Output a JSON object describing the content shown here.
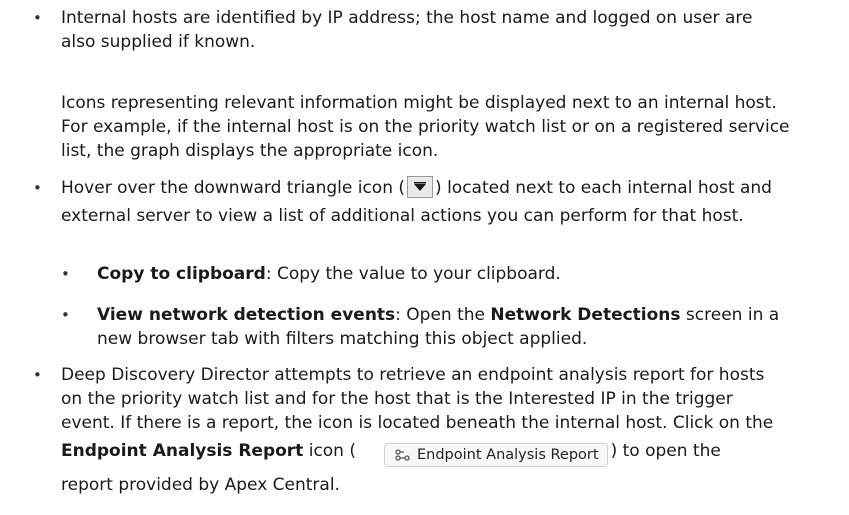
{
  "bullets": [
    {
      "lines": [
        "Internal hosts are identified by IP address; the host name and logged on user are",
        "also supplied if known."
      ],
      "paragraph": [
        "Icons representing relevant information might be displayed next to an internal host.",
        "For example, if the internal host is on the priority watch list or on a registered service",
        "list, the graph displays the appropriate icon."
      ]
    },
    {
      "line1_before": "Hover over the downward triangle icon (",
      "line1_after": ") located next to each internal host and",
      "line2": "external server to view a list of additional actions you can perform for that host.",
      "icon_name": "downward-triangle-icon",
      "subitems": [
        {
          "bold": "Copy to clipboard",
          "rest": ": Copy the value to your clipboard."
        },
        {
          "bold": "View network detection events",
          "mid": ": Open the ",
          "bold2": "Network Detections",
          "rest": " screen in a",
          "line2": "new browser tab with filters matching this object applied."
        }
      ]
    },
    {
      "lines": [
        "Deep Discovery Director attempts to retrieve an endpoint analysis report for hosts",
        "on the priority watch list and for the host that is the Interested IP in the trigger",
        "event. If there is a report, the icon is located beneath the internal host. Click on the"
      ],
      "line4_bold": "Endpoint Analysis Report",
      "line4_mid": " icon (",
      "button_label": "Endpoint Analysis Report",
      "line4_after": ") to open the",
      "line5": "report provided by Apex Central."
    }
  ],
  "bullet_char": "•"
}
